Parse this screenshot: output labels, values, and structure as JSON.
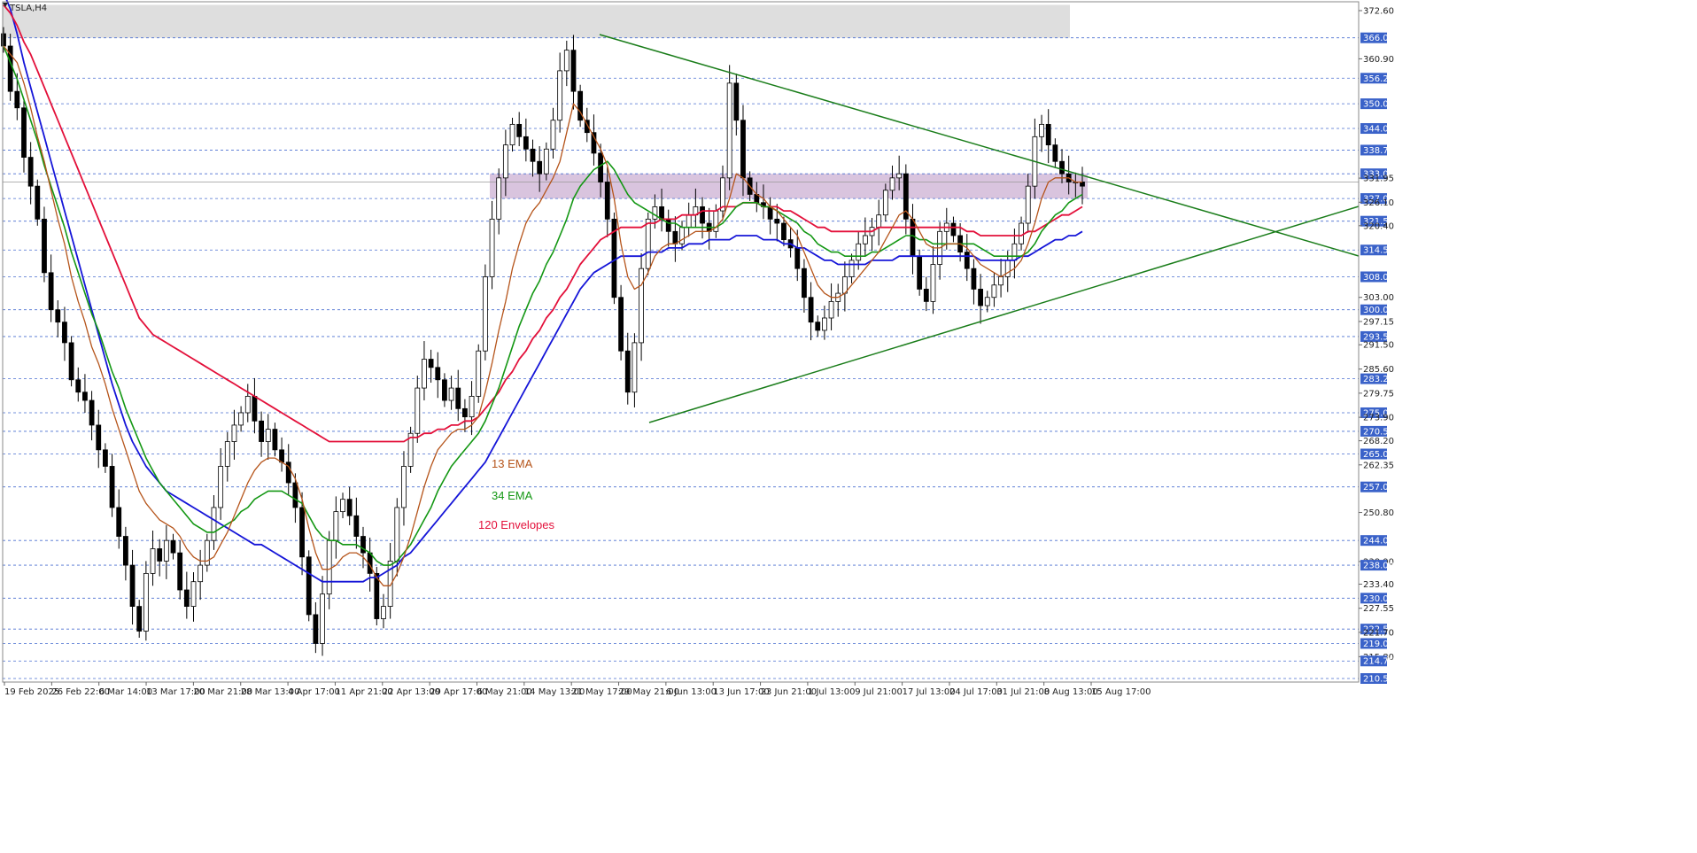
{
  "chart_data": {
    "type": "candlestick",
    "symbol_title": "TSLA,H4",
    "x_labels": [
      "19 Feb 2025",
      "26 Feb 22:00",
      "6 Mar 14:00",
      "13 Mar 17:00",
      "20 Mar 21:00",
      "28 Mar 13:00",
      "4 Apr 17:00",
      "11 Apr 21:00",
      "22 Apr 13:00",
      "29 Apr 17:00",
      "6 May 21:00",
      "14 May 13:00",
      "21 May 17:00",
      "29 May 21:00",
      "6 Jun 13:00",
      "13 Jun 17:00",
      "23 Jun 21:00",
      "1 Jul 13:00",
      "9 Jul 21:00",
      "17 Jul 13:00",
      "24 Jul 17:00",
      "31 Jul 21:00",
      "8 Aug 13:00",
      "15 Aug 17:00"
    ],
    "y_labels": [
      "372.60",
      "366.00",
      "360.90",
      "356.20",
      "350.00",
      "344.00",
      "338.75",
      "333.00",
      "331.95",
      "327.00",
      "326.10",
      "321.50",
      "320.40",
      "314.50",
      "308.00",
      "303.00",
      "300.00",
      "297.15",
      "293.50",
      "291.50",
      "285.60",
      "283.25",
      "279.75",
      "275.00",
      "273.90",
      "270.50",
      "268.20",
      "265.00",
      "262.35",
      "257.00",
      "250.80",
      "244.00",
      "238.90",
      "238.00",
      "233.40",
      "230.00",
      "227.55",
      "222.50",
      "221.70",
      "219.00",
      "215.80",
      "214.75",
      "210.50"
    ],
    "highlighted_levels": [
      "366.00",
      "356.20",
      "350.00",
      "344.00",
      "338.75",
      "333.00",
      "327.00",
      "321.50",
      "314.50",
      "308.00",
      "300.00",
      "293.50",
      "283.25",
      "275.00",
      "270.50",
      "265.00",
      "257.00",
      "244.00",
      "238.00",
      "230.00",
      "222.50",
      "219.00",
      "214.75",
      "210.50"
    ],
    "y_range": [
      210.5,
      372.6
    ],
    "resistance_zone": [
      366.0,
      374.0
    ],
    "consolidation_zone": [
      327.0,
      333.0
    ],
    "closes": [
      364,
      353,
      349,
      337,
      330,
      322,
      309,
      300,
      297,
      292,
      283,
      280,
      278,
      272,
      266,
      262,
      252,
      245,
      238,
      228,
      222,
      236,
      242,
      239,
      244,
      241,
      232,
      228,
      234,
      238,
      244,
      252,
      262,
      268,
      272,
      275,
      279,
      273,
      268,
      271,
      266,
      263,
      258,
      252,
      240,
      226,
      219,
      231,
      244,
      251,
      254,
      250,
      245,
      241,
      236,
      225,
      228,
      239,
      252,
      262,
      270,
      281,
      288,
      286,
      283,
      278,
      281,
      276,
      274,
      279,
      290,
      308,
      322,
      332,
      340,
      345,
      342,
      339,
      336,
      333,
      339,
      346,
      358,
      363,
      353,
      346,
      343,
      338,
      331,
      322,
      303,
      290,
      280,
      292,
      310,
      322,
      325,
      322,
      319,
      316,
      320,
      323,
      325,
      321,
      319,
      324,
      332,
      355,
      346,
      332,
      328,
      326,
      325,
      322,
      321,
      317,
      315,
      310,
      303,
      297,
      295,
      298,
      302,
      304,
      308,
      312,
      316,
      318,
      320,
      323,
      329,
      332,
      333,
      322,
      313,
      305,
      302,
      311,
      319,
      321,
      318,
      314,
      310,
      305,
      301,
      303,
      306,
      308,
      312,
      316,
      321,
      330,
      342,
      345,
      340,
      336,
      333,
      331,
      331,
      330
    ],
    "ema13": [
      364,
      362,
      360,
      355,
      349,
      342,
      336,
      329,
      322,
      316,
      308,
      302,
      297,
      291,
      287,
      282,
      276,
      271,
      266,
      261,
      256,
      253,
      251,
      249,
      248,
      247,
      245,
      242,
      240,
      239,
      239,
      240,
      243,
      246,
      250,
      254,
      258,
      261,
      263,
      264,
      264,
      263,
      262,
      259,
      254,
      247,
      241,
      237,
      237,
      238,
      240,
      241,
      241,
      240,
      238,
      235,
      233,
      233,
      236,
      240,
      245,
      251,
      257,
      262,
      266,
      268,
      270,
      271,
      271,
      272,
      274,
      280,
      287,
      295,
      302,
      310,
      316,
      321,
      324,
      326,
      329,
      332,
      336,
      343,
      350,
      348,
      345,
      342,
      339,
      335,
      327,
      316,
      308,
      305,
      306,
      309,
      313,
      315,
      316,
      316,
      317,
      318,
      319,
      319,
      319,
      320,
      322,
      327,
      333,
      332,
      330,
      328,
      327,
      325,
      324,
      322,
      320,
      318,
      314,
      310,
      306,
      304,
      303,
      303,
      304,
      306,
      308,
      310,
      312,
      314,
      317,
      320,
      323,
      324,
      322,
      319,
      316,
      315,
      315,
      316,
      316,
      316,
      315,
      313,
      311,
      310,
      309,
      308,
      309,
      310,
      312,
      316,
      321,
      327,
      331,
      332,
      332,
      332,
      331,
      331
    ],
    "ema34": [
      364,
      360,
      356,
      351,
      346,
      341,
      335,
      330,
      325,
      320,
      314,
      309,
      304,
      299,
      295,
      290,
      285,
      281,
      276,
      272,
      268,
      264,
      261,
      258,
      256,
      254,
      252,
      250,
      248,
      247,
      246,
      246,
      247,
      248,
      249,
      251,
      252,
      254,
      255,
      256,
      256,
      256,
      255,
      254,
      253,
      250,
      247,
      245,
      244,
      244,
      243,
      243,
      243,
      242,
      241,
      239,
      238,
      238,
      239,
      241,
      243,
      246,
      249,
      252,
      256,
      259,
      262,
      264,
      266,
      268,
      270,
      273,
      277,
      281,
      286,
      291,
      296,
      300,
      304,
      307,
      311,
      314,
      318,
      322,
      327,
      330,
      332,
      334,
      335,
      336,
      334,
      331,
      328,
      326,
      325,
      324,
      323,
      322,
      321,
      321,
      320,
      320,
      320,
      320,
      320,
      320,
      321,
      323,
      325,
      326,
      326,
      326,
      325,
      325,
      324,
      323,
      322,
      321,
      319,
      318,
      316,
      315,
      314,
      314,
      313,
      313,
      313,
      313,
      314,
      314,
      315,
      316,
      317,
      318,
      318,
      317,
      317,
      316,
      316,
      316,
      316,
      316,
      316,
      316,
      315,
      314,
      313,
      313,
      313,
      313,
      313,
      314,
      316,
      319,
      321,
      323,
      324,
      326,
      327,
      328
    ],
    "envelope_upper": [
      374,
      372,
      369,
      365,
      362,
      358,
      354,
      350,
      346,
      342,
      338,
      334,
      330,
      326,
      322,
      318,
      314,
      310,
      306,
      302,
      298,
      296,
      294,
      293,
      292,
      291,
      290,
      289,
      288,
      287,
      286,
      285,
      284,
      283,
      282,
      281,
      280,
      279,
      278,
      277,
      276,
      275,
      274,
      273,
      272,
      271,
      270,
      269,
      268,
      268,
      268,
      268,
      268,
      268,
      268,
      268,
      268,
      268,
      268,
      268,
      269,
      269,
      270,
      270,
      271,
      271,
      272,
      272,
      273,
      273,
      274,
      276,
      278,
      280,
      283,
      285,
      288,
      290,
      293,
      295,
      298,
      300,
      303,
      305,
      308,
      311,
      313,
      315,
      317,
      318,
      319,
      320,
      320,
      320,
      320,
      321,
      321,
      322,
      322,
      322,
      323,
      323,
      323,
      324,
      324,
      324,
      325,
      325,
      325,
      326,
      326,
      326,
      325,
      325,
      325,
      324,
      324,
      323,
      322,
      321,
      320,
      320,
      319,
      319,
      319,
      319,
      319,
      319,
      319,
      320,
      320,
      320,
      320,
      320,
      320,
      320,
      320,
      320,
      320,
      320,
      320,
      320,
      319,
      319,
      318,
      318,
      318,
      318,
      318,
      318,
      318,
      319,
      319,
      320,
      321,
      322,
      323,
      323,
      324,
      325
    ],
    "envelope_lower": [
      377,
      373,
      367,
      360,
      354,
      348,
      342,
      336,
      330,
      324,
      318,
      312,
      306,
      300,
      294,
      288,
      282,
      277,
      272,
      268,
      265,
      262,
      260,
      258,
      256,
      255,
      254,
      253,
      252,
      251,
      250,
      249,
      248,
      247,
      246,
      245,
      244,
      243,
      243,
      242,
      241,
      240,
      239,
      238,
      237,
      236,
      235,
      234,
      234,
      234,
      234,
      234,
      234,
      234,
      235,
      235,
      236,
      237,
      238,
      240,
      241,
      243,
      245,
      247,
      249,
      251,
      253,
      255,
      257,
      259,
      261,
      263,
      266,
      269,
      272,
      275,
      278,
      281,
      284,
      287,
      290,
      293,
      296,
      299,
      302,
      305,
      307,
      309,
      310,
      311,
      312,
      313,
      313,
      313,
      313,
      314,
      314,
      314,
      315,
      315,
      315,
      316,
      316,
      316,
      317,
      317,
      317,
      317,
      318,
      318,
      318,
      318,
      317,
      317,
      317,
      316,
      316,
      315,
      315,
      314,
      313,
      312,
      312,
      311,
      311,
      311,
      311,
      311,
      312,
      312,
      312,
      312,
      313,
      313,
      313,
      313,
      313,
      313,
      313,
      313,
      313,
      313,
      313,
      313,
      312,
      312,
      312,
      312,
      312,
      312,
      313,
      313,
      314,
      315,
      316,
      317,
      317,
      318,
      318,
      319
    ],
    "trendlines": [
      {
        "name": "descending",
        "points": [
          [
            98,
            366.5
          ],
          [
            180,
            311
          ]
        ]
      },
      {
        "name": "ascending",
        "points": [
          [
            105,
            274
          ],
          [
            180,
            322
          ]
        ]
      }
    ],
    "indicators": [
      "13 EMA",
      "34 EMA",
      "120 Envelopes"
    ],
    "colors": {
      "bull": "#ffffff",
      "bear": "#000000",
      "wick": "#000000",
      "ema13": "#b5541a",
      "ema34": "#139713",
      "envelope_upper": "#e3103a",
      "envelope_lower": "#1515d8",
      "trend": "#1a7d1a",
      "grid": "#4a6fd0",
      "highlight": "#3a62c9",
      "zone_top": "#dedede",
      "zone_mid": "#d9c4de"
    }
  }
}
